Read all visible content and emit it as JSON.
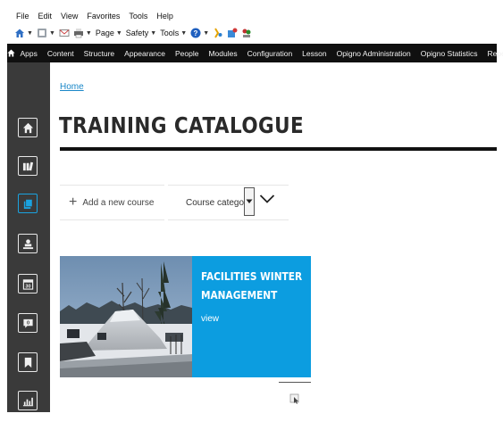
{
  "ie_menu": [
    "File",
    "Edit",
    "View",
    "Favorites",
    "Tools",
    "Help"
  ],
  "ie_commands": {
    "page": "Page",
    "safety": "Safety",
    "tools": "Tools"
  },
  "admin_bar": {
    "items": [
      "Apps",
      "Content",
      "Structure",
      "Appearance",
      "People",
      "Modules",
      "Configuration",
      "Lesson",
      "Opigno Administration",
      "Opigno Statistics",
      "Reports"
    ]
  },
  "sidebar": {
    "icons": [
      "home-icon",
      "library-icon",
      "courses-icon",
      "trainer-icon",
      "calendar-icon",
      "messages-icon",
      "bookmark-icon",
      "statistics-icon"
    ],
    "calendar_day": "30",
    "message_count": "0"
  },
  "breadcrumb": {
    "home": "Home"
  },
  "page": {
    "title": "TRAINING CATALOGUE"
  },
  "actions": {
    "add_course": "Add a new course",
    "plus_glyph": "+",
    "category_select": "Course category"
  },
  "course": {
    "title": "FACILITIES WINTER MANAGEMENT",
    "view_link": "view"
  },
  "colors": {
    "accent": "#0c9de0",
    "admin_bar": "#101010",
    "sidebar": "#3a3a3a",
    "link": "#1a87c8"
  }
}
